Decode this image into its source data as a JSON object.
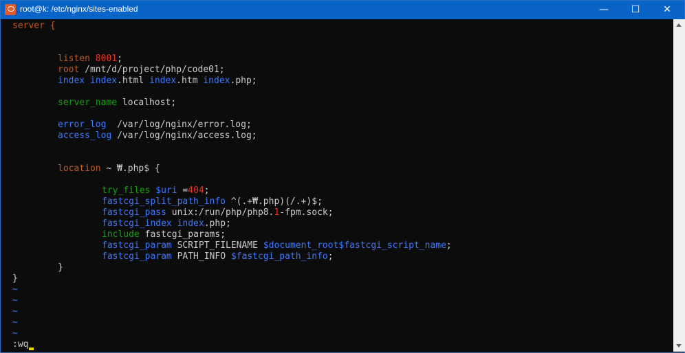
{
  "window": {
    "title": "root@k: /etc/nginx/sites-enabled",
    "minimize_glyph": "—",
    "maximize_glyph": "☐",
    "close_glyph": "✕"
  },
  "editor": {
    "line1": "server {",
    "listen_kw": "listen",
    "listen_val": "8001",
    "listen_end": ";",
    "root_kw": "root",
    "root_val": " /mnt/d/project/php/code01;",
    "index_kw": "index",
    "index_a": "index",
    "index_a_ext": ".html ",
    "index_b": "index",
    "index_b_ext": ".htm ",
    "index_c": "index",
    "index_c_ext": ".php;",
    "server_name_kw": "server_name",
    "server_name_val": " localhost;",
    "error_log_kw": "error_log",
    "error_log_val": "  /var/log/nginx/error.log;",
    "access_log_kw": "access_log",
    "access_log_val": " /var/log/nginx/access.log;",
    "location_kw": "location",
    "location_val": " ~ ₩.php$ {",
    "try_files_kw": "try_files",
    "try_files_var": " $uri",
    "try_files_eq": " =",
    "try_files_num": "404",
    "try_files_end": ";",
    "split_kw": "fastcgi_split_path_info",
    "split_val": " ^(.+₩.php)(/.+)$;",
    "pass_kw": "fastcgi_pass",
    "pass_val_a": " unix:/run/php/php8.",
    "pass_num": "1",
    "pass_val_b": "-fpm.sock;",
    "fcgi_index_kw": "fastcgi_index",
    "fcgi_index_a": " index",
    "fcgi_index_b": ".php;",
    "include_kw": "include",
    "include_val": " fastcgi_params;",
    "param1_kw": "fastcgi_param",
    "param1_name": " SCRIPT_FILENAME ",
    "param1_val": "$document_root$fastcgi_script_name",
    "param1_end": ";",
    "param2_kw": "fastcgi_param",
    "param2_name": " PATH_INFO ",
    "param2_val": "$fastcgi_path_info",
    "param2_end": ";",
    "close_inner": "}",
    "close_outer": "}",
    "tilde": "~",
    "command": ":wq"
  }
}
